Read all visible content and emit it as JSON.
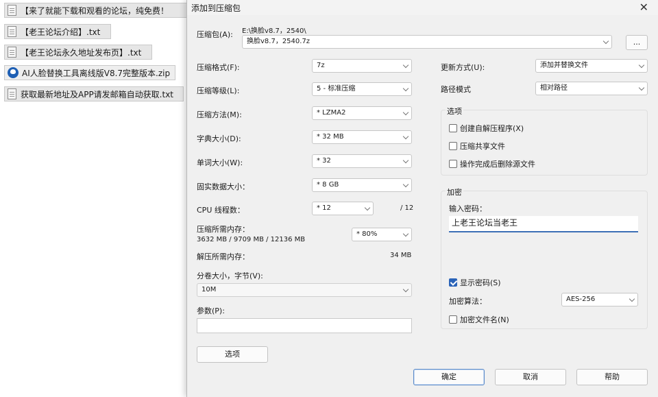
{
  "files": [
    {
      "name": "【来了就能下载和观看的论坛，纯免费！"
    },
    {
      "name": "【老王论坛介绍】.txt"
    },
    {
      "name": "【老王论坛永久地址发布页】.txt"
    },
    {
      "name": "AI人脸替换工具离线版V8.7完整版本.zip"
    },
    {
      "name": "获取最新地址及APP请发邮箱自动获取.txt"
    }
  ],
  "dialog": {
    "title": "添加到压缩包",
    "close_icon": "close-icon",
    "archive": {
      "label": "压缩包(A):",
      "path": "E:\\换脸v8.7，2540\\",
      "value": "换脸v8.7，2540.7z",
      "browse": "..."
    },
    "left": {
      "format_label": "压缩格式(F):",
      "format_value": "7z",
      "level_label": "压缩等级(L):",
      "level_value": "5 - 标准压缩",
      "method_label": "压缩方法(M):",
      "method_value": "* LZMA2",
      "dict_label": "字典大小(D):",
      "dict_value": "* 32 MB",
      "word_label": "单词大小(W):",
      "word_value": "* 32",
      "solid_label": "固实数据大小：",
      "solid_value": "* 8 GB",
      "cpu_label": "CPU 线程数：",
      "cpu_value": "* 12",
      "cpu_max": "/ 12",
      "mem_label": "压缩所需内存：",
      "mem_detail": "3632 MB / 9709 MB / 12136 MB",
      "mem_value": "* 80%",
      "decomp_label": "解压所需内存：",
      "decomp_value": "34 MB",
      "split_label": "分卷大小，字节(V):",
      "split_value": "10M",
      "params_label": "参数(P):",
      "params_value": "",
      "options_button": "选项"
    },
    "right": {
      "update_label": "更新方式(U):",
      "update_value": "添加并替换文件",
      "pathmode_label": "路径模式",
      "pathmode_value": "相对路径",
      "options_group": "选项",
      "opt_sfx": "创建自解压程序(X)",
      "opt_shared": "压缩共享文件",
      "opt_delete": "操作完成后删除源文件",
      "encrypt_group": "加密",
      "password_label": "输入密码：",
      "password_value": "上老王论坛当老王",
      "show_password": "显示密码(S)",
      "enc_method_label": "加密算法：",
      "enc_method_value": "AES-256",
      "encrypt_names": "加密文件名(N)"
    },
    "buttons": {
      "ok": "确定",
      "cancel": "取消",
      "help": "帮助"
    }
  }
}
